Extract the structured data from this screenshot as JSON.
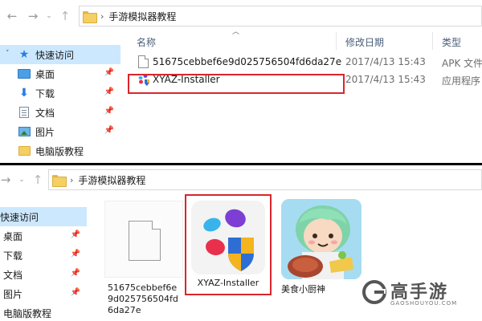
{
  "top": {
    "breadcrumb": "手游模拟器教程",
    "sidebar": [
      {
        "label": "快速访问",
        "icon": "star-icon",
        "selected": true,
        "pinned": false
      },
      {
        "label": "桌面",
        "icon": "desktop-icon",
        "pinned": true
      },
      {
        "label": "下载",
        "icon": "download-icon",
        "pinned": true
      },
      {
        "label": "文档",
        "icon": "document-icon",
        "pinned": true
      },
      {
        "label": "图片",
        "icon": "picture-icon",
        "pinned": true
      },
      {
        "label": "电脑版教程",
        "icon": "folder-icon",
        "pinned": false
      }
    ],
    "columns": {
      "name": "名称",
      "date": "修改日期",
      "type": "类型"
    },
    "files": [
      {
        "name": "51675cebbef6e9d025756504fd6da27e",
        "date": "2017/4/13 15:43",
        "type": "APK 文件",
        "icon": "file-icon"
      },
      {
        "name": "XYAZ-Installer",
        "date": "2017/4/13 15:43",
        "type": "应用程序",
        "icon": "xyaz-app-icon",
        "highlighted": true
      }
    ]
  },
  "bottom": {
    "breadcrumb": "手游模拟器教程",
    "sidebar": [
      {
        "label": "快速访问",
        "selected": true
      },
      {
        "label": "桌面",
        "pinned": true
      },
      {
        "label": "下载",
        "pinned": true
      },
      {
        "label": "文档",
        "pinned": true
      },
      {
        "label": "图片",
        "pinned": true
      },
      {
        "label": "电脑版教程",
        "pinned": false
      }
    ],
    "tiles": [
      {
        "label_lines": [
          "51675cebbef6e",
          "9d025756504fd",
          "6da27e"
        ],
        "icon": "blank-file-icon"
      },
      {
        "label_lines": [
          "XYAZ-Installer"
        ],
        "icon": "xyaz-app-icon",
        "highlighted": true
      },
      {
        "label_lines": [
          "美食小厨神"
        ],
        "icon": "game-app-icon"
      }
    ]
  },
  "watermark": {
    "main": "高手游",
    "sub": "GAOSHOUYOU.COM"
  },
  "colors": {
    "highlight": "#d9262b",
    "selected_bg": "#cce8ff",
    "accent": "#2a7de1"
  }
}
